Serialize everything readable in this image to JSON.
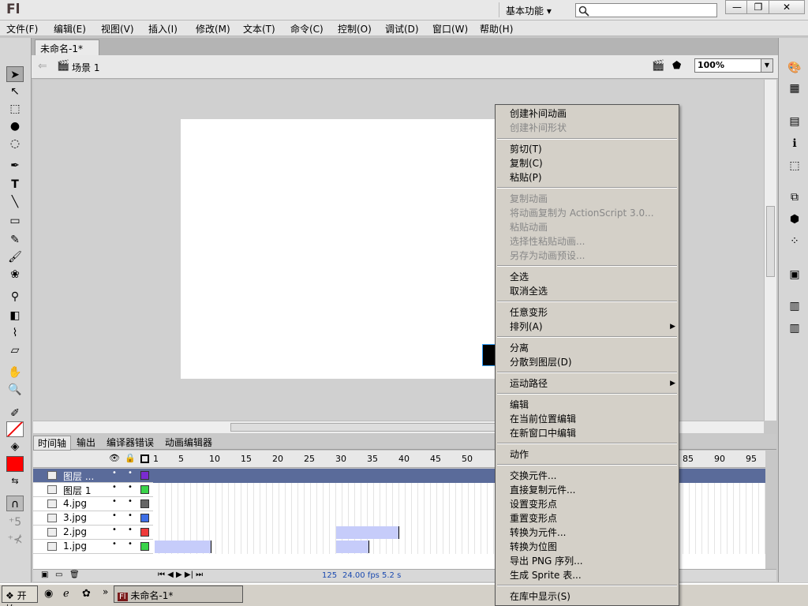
{
  "app": {
    "logo": "Fl",
    "workspace": "基本功能 ▾",
    "search_placeholder": ""
  },
  "window_buttons": {
    "min": "—",
    "max": "❐",
    "close": "✕"
  },
  "menubar": [
    "文件(F)",
    "编辑(E)",
    "视图(V)",
    "插入(I)",
    "修改(M)",
    "文本(T)",
    "命令(C)",
    "控制(O)",
    "调试(D)",
    "窗口(W)",
    "帮助(H)"
  ],
  "document": {
    "tab_label": "未命名-1*",
    "tab_close": "×",
    "scene_label": "场景 1",
    "zoom": "100%"
  },
  "timeline": {
    "tabs": [
      "时间轴",
      "输出",
      "编译器错误",
      "动画编辑器"
    ],
    "ruler": [
      "1",
      "5",
      "10",
      "15",
      "20",
      "25",
      "30",
      "35",
      "40",
      "45",
      "50",
      "85",
      "90",
      "95"
    ],
    "layers": [
      {
        "name": "图层 ...",
        "color": "#7a2bd0"
      },
      {
        "name": "图层 1",
        "color": "#3ad44a"
      },
      {
        "name": "4.jpg",
        "color": "#666666"
      },
      {
        "name": "3.jpg",
        "color": "#3d6ee6"
      },
      {
        "name": "2.jpg",
        "color": "#ee3a3a"
      },
      {
        "name": "1.jpg",
        "color": "#3ad44a"
      }
    ],
    "footer": {
      "frame": "125",
      "fps": "24.00 fps",
      "time": "5.2 s"
    }
  },
  "context_menu": {
    "items": [
      {
        "label": "创建补间动画",
        "enabled": true
      },
      {
        "label": "创建补间形状",
        "enabled": false
      },
      {
        "label": "剪切(T)",
        "enabled": true
      },
      {
        "label": "复制(C)",
        "enabled": true
      },
      {
        "label": "粘贴(P)",
        "enabled": true
      },
      {
        "label": "复制动画",
        "enabled": false
      },
      {
        "label": "将动画复制为 ActionScript 3.0...",
        "enabled": false
      },
      {
        "label": "粘贴动画",
        "enabled": false
      },
      {
        "label": "选择性粘贴动画...",
        "enabled": false
      },
      {
        "label": "另存为动画预设...",
        "enabled": false
      },
      {
        "label": "全选",
        "enabled": true
      },
      {
        "label": "取消全选",
        "enabled": true
      },
      {
        "label": "任意变形",
        "enabled": true
      },
      {
        "label": "排列(A)",
        "enabled": true
      },
      {
        "label": "分离",
        "enabled": true
      },
      {
        "label": "分散到图层(D)",
        "enabled": true
      },
      {
        "label": "运动路径",
        "enabled": true
      },
      {
        "label": "编辑",
        "enabled": true
      },
      {
        "label": "在当前位置编辑",
        "enabled": true
      },
      {
        "label": "在新窗口中编辑",
        "enabled": true
      },
      {
        "label": "动作",
        "enabled": true
      },
      {
        "label": "交换元件...",
        "enabled": true
      },
      {
        "label": "直接复制元件...",
        "enabled": true
      },
      {
        "label": "设置变形点",
        "enabled": true
      },
      {
        "label": "重置变形点",
        "enabled": true
      },
      {
        "label": "转换为元件...",
        "enabled": true
      },
      {
        "label": "转换为位图",
        "enabled": true
      },
      {
        "label": "导出 PNG 序列...",
        "enabled": true
      },
      {
        "label": "生成 Sprite 表...",
        "enabled": true
      },
      {
        "label": "在库中显示(S)",
        "enabled": true
      }
    ]
  },
  "taskbar": {
    "start": "开始",
    "task": "未命名-1*",
    "chevron": "»"
  }
}
